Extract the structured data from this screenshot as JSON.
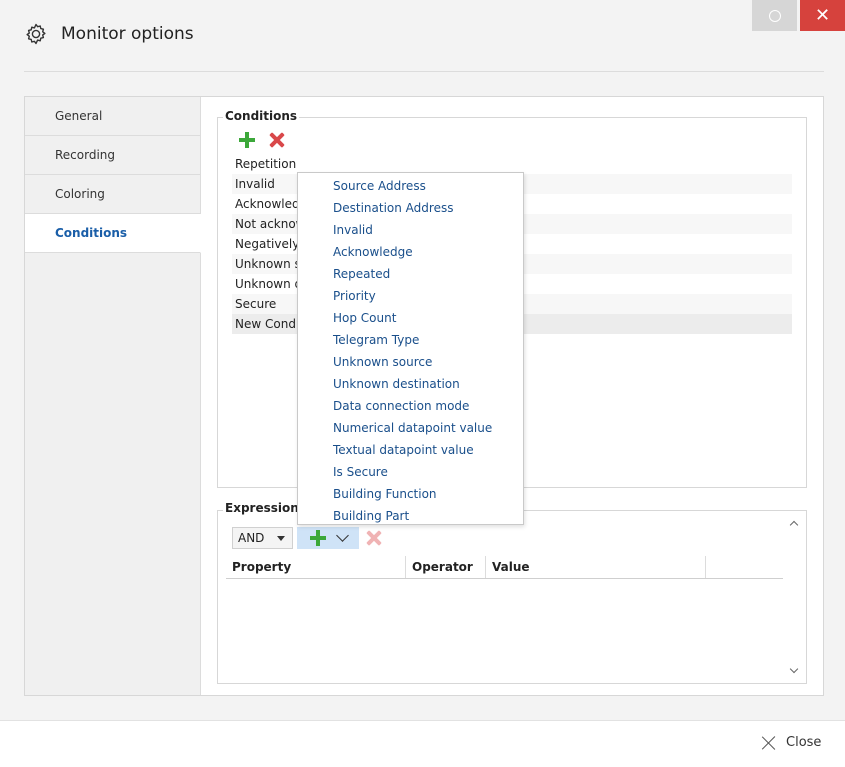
{
  "window": {
    "title": "Monitor options",
    "icon": "gear-icon",
    "close_label": "Close"
  },
  "nav": {
    "items": [
      {
        "label": "General"
      },
      {
        "label": "Recording"
      },
      {
        "label": "Coloring"
      },
      {
        "label": "Conditions",
        "active": true
      }
    ]
  },
  "conditions": {
    "title": "Conditions",
    "rows": [
      "Repetition",
      "Invalid",
      "Acknowledg",
      "Not acknow",
      "Negatively a",
      "Unknown so",
      "Unknown de",
      "Secure",
      "New Condit"
    ]
  },
  "dropdown": {
    "items": [
      "Source Address",
      "Destination Address",
      "Invalid",
      "Acknowledge",
      "Repeated",
      "Priority",
      "Hop Count",
      "Telegram Type",
      "Unknown source",
      "Unknown destination",
      "Data connection mode",
      "Numerical datapoint value",
      "Textual datapoint value",
      "Is Secure",
      "Building Function",
      "Building Part"
    ]
  },
  "expression": {
    "title": "Expression",
    "operator_value": "AND",
    "columns": [
      "Property",
      "Operator",
      "Value",
      ""
    ]
  },
  "colors": {
    "accent": "#1a5ea8",
    "add_green": "#3ca83a",
    "remove_red": "#d9484a",
    "close_red": "#d6423d"
  }
}
